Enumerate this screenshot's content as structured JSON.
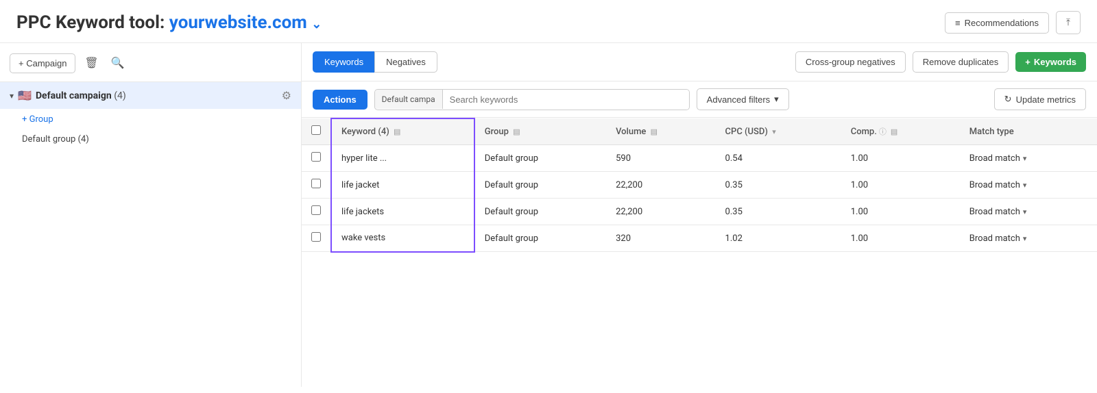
{
  "header": {
    "title": "PPC Keyword tool:",
    "domain": "yourwebsite.com",
    "recommendations_label": "Recommendations",
    "export_icon": "export-icon"
  },
  "sidebar": {
    "add_campaign_label": "+ Campaign",
    "delete_icon": "trash-icon",
    "search_icon": "search-icon",
    "campaign": {
      "flag": "🇺🇸",
      "name": "Default campaign",
      "count": "(4)",
      "settings_icon": "settings-icon"
    },
    "add_group_label": "+ Group",
    "group_item": "Default group (4)"
  },
  "tabs": {
    "keywords_label": "Keywords",
    "negatives_label": "Negatives",
    "cross_group_negatives_label": "Cross-group negatives",
    "remove_duplicates_label": "Remove duplicates",
    "add_keywords_label": "+ Keywords"
  },
  "actions_bar": {
    "actions_label": "Actions",
    "search_placeholder": "Search keywords",
    "campaign_filter_label": "Default campa",
    "advanced_filters_label": "Advanced filters",
    "update_metrics_label": "Update metrics"
  },
  "table": {
    "columns": [
      {
        "label": "Keyword (4)",
        "key": "keyword",
        "sortable": true
      },
      {
        "label": "Group",
        "key": "group",
        "sortable": true
      },
      {
        "label": "Volume",
        "key": "volume",
        "sortable": true
      },
      {
        "label": "CPC (USD)",
        "key": "cpc",
        "sortable": true,
        "has_down_arrow": true
      },
      {
        "label": "Comp.",
        "key": "comp",
        "sortable": true,
        "has_info": true
      },
      {
        "label": "Match type",
        "key": "match_type",
        "sortable": false
      }
    ],
    "rows": [
      {
        "keyword": "hyper lite ...",
        "group": "Default group",
        "volume": "590",
        "cpc": "0.54",
        "comp": "1.00",
        "match_type": "Broad match"
      },
      {
        "keyword": "life jacket",
        "group": "Default group",
        "volume": "22,200",
        "cpc": "0.35",
        "comp": "1.00",
        "match_type": "Broad match"
      },
      {
        "keyword": "life jackets",
        "group": "Default group",
        "volume": "22,200",
        "cpc": "0.35",
        "comp": "1.00",
        "match_type": "Broad match"
      },
      {
        "keyword": "wake vests",
        "group": "Default group",
        "volume": "320",
        "cpc": "1.02",
        "comp": "1.00",
        "match_type": "Broad match"
      }
    ]
  },
  "colors": {
    "primary_blue": "#1a73e8",
    "green": "#34a853",
    "purple_border": "#7c4dff",
    "active_tab_bg": "#1a73e8"
  }
}
